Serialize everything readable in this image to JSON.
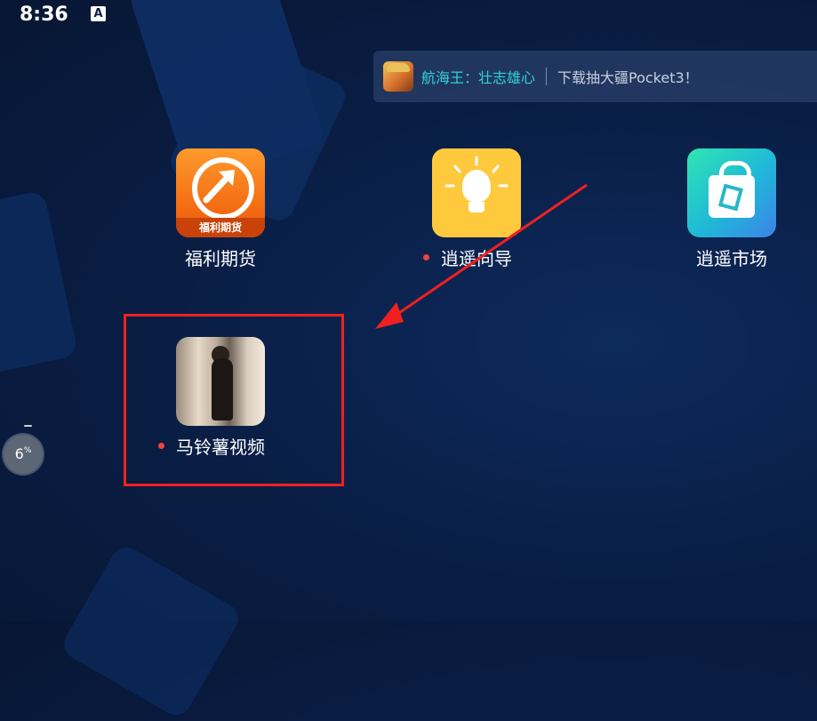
{
  "status_bar": {
    "time": "8:36",
    "indicator": "A"
  },
  "banner": {
    "title": "航海王：壮志雄心",
    "subtitle": "下载抽大疆Pocket3！",
    "avatar_icon": "one-piece-avatar-icon"
  },
  "apps": [
    {
      "label": "福利期货",
      "icon": "futures-arrow-icon",
      "icon_text": "福利期货",
      "notification_dot": false
    },
    {
      "label": "逍遥向导",
      "icon": "light-bulb-icon",
      "notification_dot": true
    },
    {
      "label": "逍遥市场",
      "icon": "shopping-bag-icon",
      "notification_dot": false
    },
    {
      "label": "马铃薯视频",
      "icon": "video-thumbnail-icon",
      "notification_dot": true
    }
  ],
  "gauge": {
    "value": "6",
    "unit": "%"
  },
  "colors": {
    "highlight": "#f02020",
    "dot": "#ef4242",
    "banner_title": "#2fd3d8"
  }
}
